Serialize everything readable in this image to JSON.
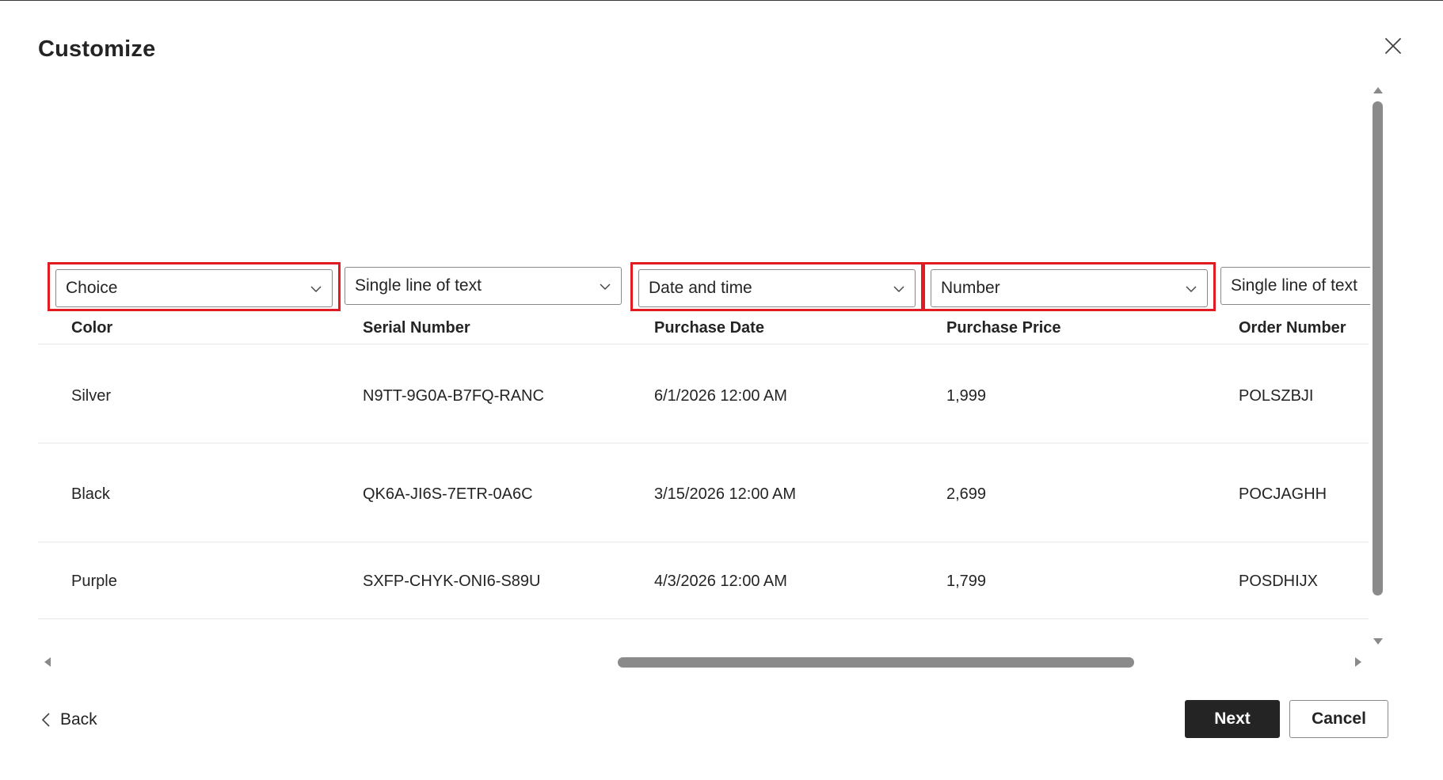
{
  "dialog": {
    "title": "Customize",
    "close_icon": "close-icon"
  },
  "columns": [
    {
      "type": "Choice",
      "header": "Color",
      "highlighted": true
    },
    {
      "type": "Single line of text",
      "header": "Serial Number",
      "highlighted": false
    },
    {
      "type": "Date and time",
      "header": "Purchase Date",
      "highlighted": true
    },
    {
      "type": "Number",
      "header": "Purchase Price",
      "highlighted": true
    },
    {
      "type": "Single line of text",
      "header": "Order Number",
      "highlighted": false
    }
  ],
  "rows": [
    [
      "Silver",
      "N9TT-9G0A-B7FQ-RANC",
      "6/1/2026 12:00 AM",
      "1,999",
      "POLSZBJI"
    ],
    [
      "Black",
      "QK6A-JI6S-7ETR-0A6C",
      "3/15/2026 12:00 AM",
      "2,699",
      "POCJAGHH"
    ],
    [
      "Purple",
      "SXFP-CHYK-ONI6-S89U",
      "4/3/2026 12:00 AM",
      "1,799",
      "POSDHIJX"
    ]
  ],
  "footer": {
    "back_label": "Back",
    "next_label": "Next",
    "cancel_label": "Cancel"
  },
  "colors": {
    "highlight": "#e11b22",
    "primary_button": "#242424",
    "scrollbar": "#8a8a8a"
  }
}
